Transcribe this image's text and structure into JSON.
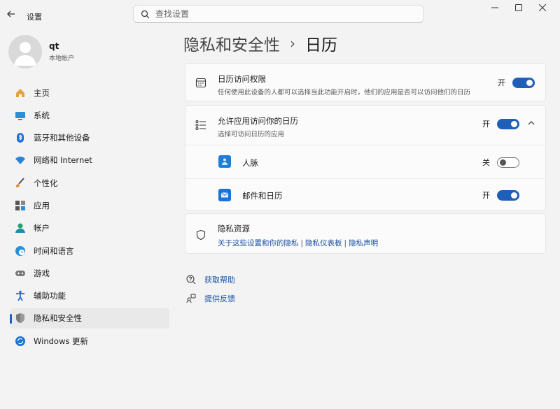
{
  "window": {
    "title": "设置"
  },
  "search": {
    "placeholder": "查找设置"
  },
  "profile": {
    "name": "qt",
    "account_type": "本地帐户"
  },
  "sidebar": {
    "items": [
      {
        "label": "主页",
        "icon": "home-icon"
      },
      {
        "label": "系统",
        "icon": "monitor-icon"
      },
      {
        "label": "蓝牙和其他设备",
        "icon": "bluetooth-icon"
      },
      {
        "label": "网络和 Internet",
        "icon": "wifi-icon"
      },
      {
        "label": "个性化",
        "icon": "brush-icon"
      },
      {
        "label": "应用",
        "icon": "apps-icon"
      },
      {
        "label": "帐户",
        "icon": "account-icon"
      },
      {
        "label": "时间和语言",
        "icon": "clock-globe-icon"
      },
      {
        "label": "游戏",
        "icon": "gamepad-icon"
      },
      {
        "label": "辅助功能",
        "icon": "accessibility-icon"
      },
      {
        "label": "隐私和安全性",
        "icon": "shield-icon",
        "selected": true
      },
      {
        "label": "Windows 更新",
        "icon": "update-icon"
      }
    ]
  },
  "breadcrumb": {
    "parent": "隐私和安全性",
    "separator": "›",
    "current": "日历"
  },
  "calendar_access": {
    "title": "日历访问权限",
    "description": "任何使用此设备的人都可以选择当此功能开启时，他们的应用是否可以访问他们的日历",
    "state_label": "开",
    "enabled": true,
    "icon": "calendar-icon"
  },
  "app_access": {
    "title": "允许应用访问你的日历",
    "description": "选择可访问日历的应用",
    "state_label": "开",
    "enabled": true,
    "icon": "list-icon",
    "expanded": true,
    "apps": [
      {
        "name": "人脉",
        "state_label": "关",
        "enabled": false,
        "icon": "people-app-icon",
        "color": "#1f7fd8"
      },
      {
        "name": "邮件和日历",
        "state_label": "开",
        "enabled": true,
        "icon": "mail-app-icon",
        "color": "#1d74d4"
      }
    ]
  },
  "privacy_resources": {
    "title": "隐私资源",
    "links": [
      "关于这些设置和你的隐私",
      "隐私仪表板",
      "隐私声明"
    ],
    "separator": "|",
    "icon": "shield-outline-icon"
  },
  "help": {
    "get_help": "获取帮助",
    "feedback": "提供反馈"
  },
  "colors": {
    "accent": "#1f5fb8",
    "link": "#1a4fa3",
    "background": "#f3f3f3",
    "card": "#fbfbfb"
  }
}
